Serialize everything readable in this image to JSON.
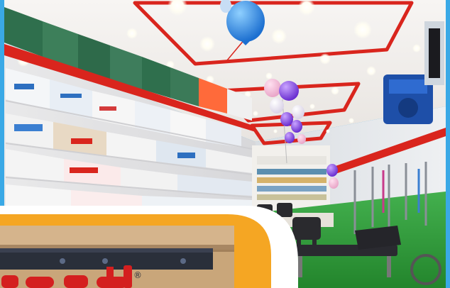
{
  "image": {
    "kind": "photo",
    "subject": "medical-supply-store-interior",
    "colors": {
      "frame_border": "#3aa9e6",
      "ceiling": "#f4f1ee",
      "ceiling_trim": "#d9251d",
      "shelf_edge": "#d9251d",
      "floor": "#2f9b3a",
      "inset_orange": "#f5a623",
      "inset_white": "#ffffff",
      "sign_red": "#d41f1f"
    }
  },
  "visible_text": {
    "inset_sign": "",
    "inset_registered_mark": "®"
  }
}
